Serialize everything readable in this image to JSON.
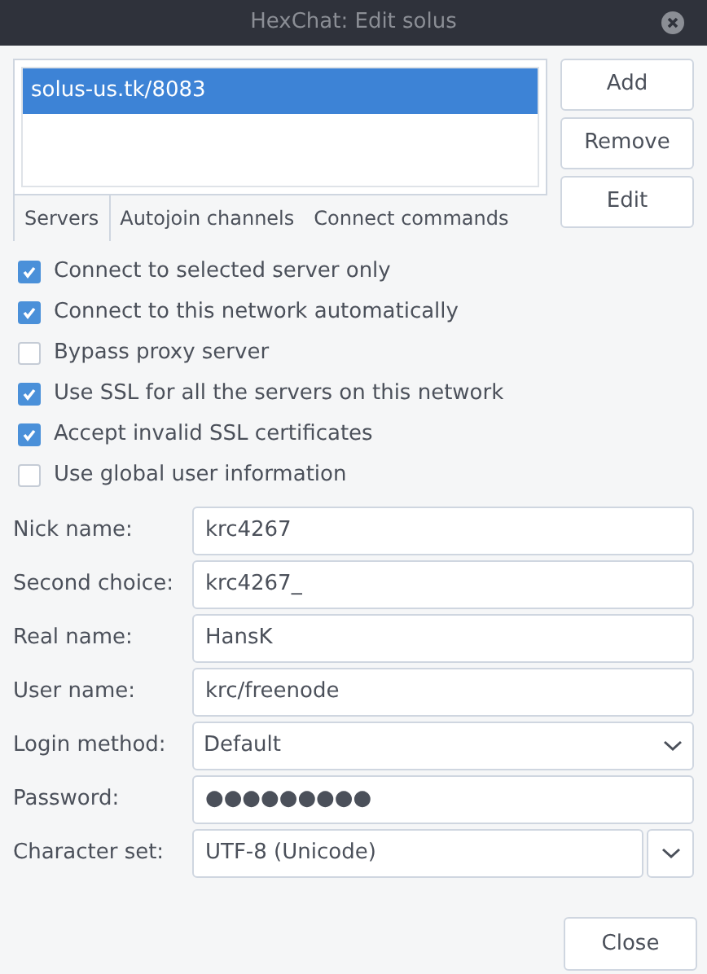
{
  "window": {
    "title": "HexChat: Edit solus"
  },
  "servers": [
    {
      "label": "solus-us.tk/8083",
      "selected": true
    }
  ],
  "server_buttons": [
    "Add",
    "Remove",
    "Edit"
  ],
  "tabs": [
    {
      "label": "Servers",
      "selected": true
    },
    {
      "label": "Autojoin channels",
      "selected": false
    },
    {
      "label": "Connect commands",
      "selected": false
    }
  ],
  "options": [
    {
      "label": "Connect to selected server only",
      "checked": true
    },
    {
      "label": "Connect to this network automatically",
      "checked": true
    },
    {
      "label": "Bypass proxy server",
      "checked": false
    },
    {
      "label": "Use SSL for all the servers on this network",
      "checked": true
    },
    {
      "label": "Accept invalid SSL certificates",
      "checked": true
    },
    {
      "label": "Use global user information",
      "checked": false
    }
  ],
  "fields": [
    {
      "label": "Nick name:",
      "kind": "text",
      "value": "krc4267"
    },
    {
      "label": "Second choice:",
      "kind": "text",
      "value": "krc4267_"
    },
    {
      "label": "Real name:",
      "kind": "text",
      "value": "HansK"
    },
    {
      "label": "User name:",
      "kind": "text",
      "value": "krc/freenode"
    },
    {
      "label": "Login method:",
      "kind": "dropdown",
      "value": "Default"
    },
    {
      "label": "Password:",
      "kind": "password",
      "value": "●●●●●●●●●"
    },
    {
      "label": "Character set:",
      "kind": "combo",
      "value": "UTF-8 (Unicode)"
    }
  ],
  "close_button": "Close"
}
